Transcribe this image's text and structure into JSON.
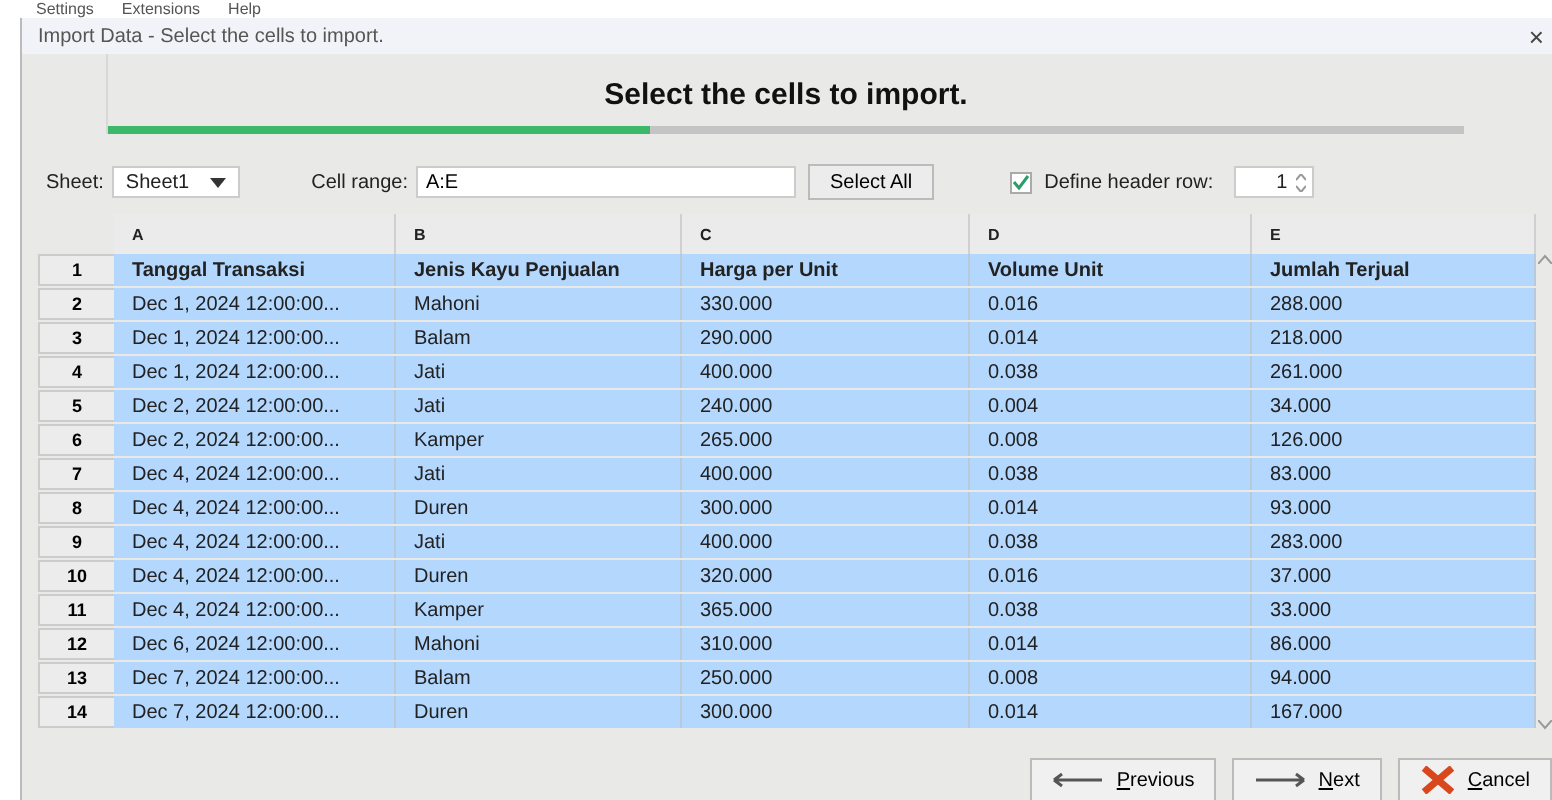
{
  "menu": [
    "Settings",
    "Extensions",
    "Help"
  ],
  "window": {
    "title": "Import Data - Select the cells to import.",
    "close": "×"
  },
  "step": {
    "heading": "Select the cells to import.",
    "level": 0.4
  },
  "options": {
    "sheet_label": "Sheet:",
    "sheet": "Sheet1",
    "range_label": "Cell range:",
    "range": "A:E",
    "select_all": "Select All",
    "header_label": "Define header row:",
    "header_checked": true,
    "header_row": "1"
  },
  "table": {
    "columns": [
      "A",
      "B",
      "C",
      "D",
      "E"
    ],
    "rows": [
      {
        "num": "1",
        "header": true,
        "selected": true,
        "cells": [
          "Tanggal Transaksi",
          "Jenis Kayu Penjualan",
          "Harga per Unit",
          "Volume Unit",
          "Jumlah Terjual"
        ]
      },
      {
        "num": "2",
        "header": false,
        "selected": true,
        "cells": [
          "Dec 1, 2024 12:00:00...",
          "Mahoni",
          "330.000",
          "0.016",
          "288.000"
        ]
      },
      {
        "num": "3",
        "header": false,
        "selected": true,
        "cells": [
          "Dec 1, 2024 12:00:00...",
          "Balam",
          "290.000",
          "0.014",
          "218.000"
        ]
      },
      {
        "num": "4",
        "header": false,
        "selected": true,
        "cells": [
          "Dec 1, 2024 12:00:00...",
          "Jati",
          "400.000",
          "0.038",
          "261.000"
        ]
      },
      {
        "num": "5",
        "header": false,
        "selected": true,
        "cells": [
          "Dec 2, 2024 12:00:00...",
          "Jati",
          "240.000",
          "0.004",
          "34.000"
        ]
      },
      {
        "num": "6",
        "header": false,
        "selected": true,
        "cells": [
          "Dec 2, 2024 12:00:00...",
          "Kamper",
          "265.000",
          "0.008",
          "126.000"
        ]
      },
      {
        "num": "7",
        "header": false,
        "selected": true,
        "cells": [
          "Dec 4, 2024 12:00:00...",
          "Jati",
          "400.000",
          "0.038",
          "83.000"
        ]
      },
      {
        "num": "8",
        "header": false,
        "selected": true,
        "cells": [
          "Dec 4, 2024 12:00:00...",
          "Duren",
          "300.000",
          "0.014",
          "93.000"
        ]
      },
      {
        "num": "9",
        "header": false,
        "selected": true,
        "cells": [
          "Dec 4, 2024 12:00:00...",
          "Jati",
          "400.000",
          "0.038",
          "283.000"
        ]
      },
      {
        "num": "10",
        "header": false,
        "selected": true,
        "cells": [
          "Dec 4, 2024 12:00:00...",
          "Duren",
          "320.000",
          "0.016",
          "37.000"
        ]
      },
      {
        "num": "11",
        "header": false,
        "selected": true,
        "cells": [
          "Dec 4, 2024 12:00:00...",
          "Kamper",
          "365.000",
          "0.038",
          "33.000"
        ]
      },
      {
        "num": "12",
        "header": false,
        "selected": true,
        "cells": [
          "Dec 6, 2024 12:00:00...",
          "Mahoni",
          "310.000",
          "0.014",
          "86.000"
        ]
      },
      {
        "num": "13",
        "header": false,
        "selected": true,
        "cells": [
          "Dec 7, 2024 12:00:00...",
          "Balam",
          "250.000",
          "0.008",
          "94.000"
        ]
      },
      {
        "num": "14",
        "header": false,
        "selected": true,
        "cells": [
          "Dec 7, 2024 12:00:00...",
          "Duren",
          "300.000",
          "0.014",
          "167.000"
        ]
      }
    ]
  },
  "buttons": [
    {
      "kind": "previous",
      "label": "Previous"
    },
    {
      "kind": "next",
      "label": "Next"
    },
    {
      "kind": "cancel",
      "label": "Cancel"
    }
  ]
}
